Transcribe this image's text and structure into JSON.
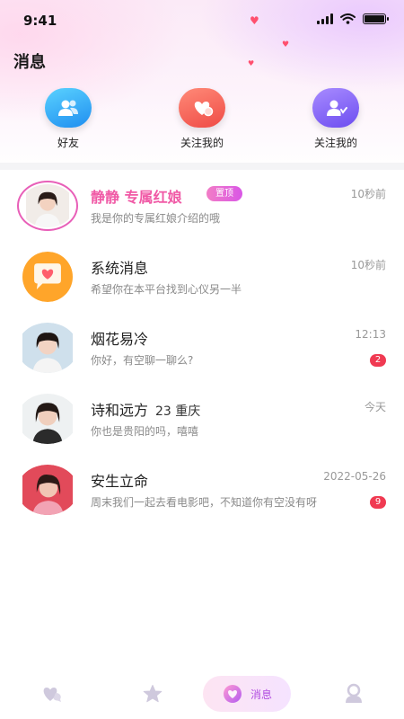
{
  "status_bar": {
    "time": "9:41"
  },
  "header": {
    "title": "消息"
  },
  "quick_actions": [
    {
      "label": "好友",
      "icon": "friends-icon"
    },
    {
      "label": "关注我的",
      "icon": "heart-follow-icon"
    },
    {
      "label": "关注我的",
      "icon": "user-follow-icon"
    }
  ],
  "conversations": [
    {
      "name": "静静 专属红娘",
      "badge": "置顶",
      "preview": "我是你的专属红娘介绍的哦",
      "time": "10秒前",
      "unread": ""
    },
    {
      "name": "系统消息",
      "preview": "希望你在本平台找到心仪另一半",
      "time": "10秒前",
      "unread": ""
    },
    {
      "name": "烟花易冷",
      "preview": "你好，有空聊一聊么?",
      "time": "12:13",
      "unread": "2"
    },
    {
      "name": "诗和远方",
      "extra": "23 重庆",
      "preview": "你也是贵阳的吗，嘻嘻",
      "time": "今天",
      "unread": ""
    },
    {
      "name": "安生立命",
      "preview": "周末我们一起去看电影吧，不知道你有空没有呀",
      "time": "2022-05-26",
      "unread": "9"
    }
  ],
  "tabbar": {
    "items": [
      {
        "icon": "heart-chat-icon"
      },
      {
        "icon": "star-icon"
      },
      {
        "icon": "message-bubble-icon",
        "label": "消息",
        "active": true
      },
      {
        "icon": "profile-icon"
      }
    ]
  },
  "colors": {
    "accent_pink": "#f05aa6",
    "badge_red": "#f03a52",
    "active_tab": "#b24ee0"
  }
}
